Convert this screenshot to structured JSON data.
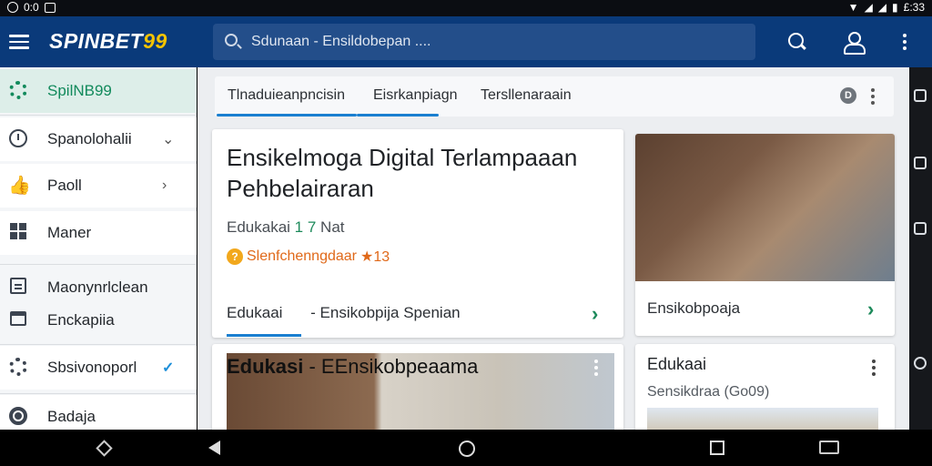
{
  "status_bar": {
    "left_text": "0:0",
    "right_text": "£:33"
  },
  "app": {
    "brand_main": "SPINBET",
    "brand_accent": "99",
    "search_placeholder": "Sdunaan - Ensildobepan ....",
    "colors": {
      "appbar": "#0a3a7a",
      "active_green": "#128a5c",
      "accent_blue": "#1a7fd0"
    }
  },
  "sidebar": {
    "items": [
      {
        "label": "SpilNB99",
        "icon": "gear-icon",
        "active": true
      },
      {
        "label": "Spanolohalii",
        "icon": "clock-icon",
        "trailing": "⌄"
      },
      {
        "label": "Paoll",
        "icon": "thumb-icon",
        "trailing": "›"
      },
      {
        "label": "Maner",
        "icon": "grid-icon"
      },
      {
        "label": "Maonynrlclean",
        "icon": "book-icon"
      },
      {
        "label": "Enckapiia",
        "icon": "calendar-icon"
      },
      {
        "label": "Sbsivonoporl",
        "icon": "settings-icon",
        "trailing": "✓"
      },
      {
        "label": "Badaja",
        "icon": "badge-icon"
      }
    ]
  },
  "tabs": [
    {
      "label": "Tlnaduieanpncisin"
    },
    {
      "label": "Eisrkanpiagn"
    },
    {
      "label": "Tersllenaraain"
    }
  ],
  "tab_actions": {
    "info_label": "D"
  },
  "cards": {
    "featured": {
      "title": "Ensikelmoga Digital Terlampaaan Pehbelairaran",
      "meta_label": "Edukakai",
      "meta_num": "1 7",
      "meta_extra": "Nat",
      "rating_text": "Slenfchenngdaar",
      "rating_stars": "★13",
      "footer_left": "Edukaai",
      "footer_right": "- Ensikobpija Spenian"
    },
    "image_card": {
      "caption": "Ensikobpoaja"
    },
    "bottom_left": {
      "title_bold": "Edukasi",
      "title_rest": " - EEnsikobpeaama"
    },
    "bottom_right": {
      "title": "Edukaai",
      "subtitle": "Sensikdraa (Go09)"
    }
  }
}
